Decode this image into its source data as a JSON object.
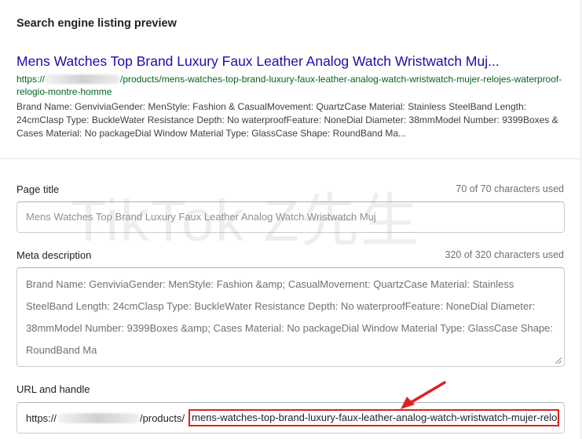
{
  "preview": {
    "heading": "Search engine listing preview",
    "title": "Mens Watches Top Brand Luxury Faux Leather Analog Watch Wristwatch Muj...",
    "url_prefix": "https://",
    "url_path": "/products/mens-watches-top-brand-luxury-faux-leather-analog-watch-wristwatch-mujer-relojes-waterproof-relogio-montre-homme",
    "description": "Brand Name: GenviviaGender: MenStyle: Fashion & CasualMovement: QuartzCase Material: Stainless SteelBand Length: 24cmClasp Type: BuckleWater Resistance Depth: No waterproofFeature: NoneDial Diameter: 38mmModel Number: 9399Boxes & Cases Material: No packageDial Window Material Type: GlassCase Shape: RoundBand Ma..."
  },
  "page_title": {
    "label": "Page title",
    "counter": "70 of 70 characters used",
    "value": "Mens Watches Top Brand Luxury Faux Leather Analog Watch Wristwatch Muj"
  },
  "meta_description": {
    "label": "Meta description",
    "counter": "320 of 320 characters used",
    "value": "Brand Name: GenviviaGender: MenStyle: Fashion &amp; CasualMovement: QuartzCase Material: Stainless SteelBand Length: 24cmClasp Type: BuckleWater Resistance Depth: No waterproofFeature: NoneDial Diameter: 38mmModel Number: 9399Boxes &amp; Cases Material: No packageDial Window Material Type: GlassCase Shape: RoundBand Ma"
  },
  "url_handle": {
    "label": "URL and handle",
    "prefix_start": "https://",
    "prefix_end": "/products/",
    "handle": "mens-watches-top-brand-luxury-faux-leather-analog-watch-wristwatch-mujer-relojes-waterproof-relogio-montre-homme"
  },
  "watermark": "TikTok Z先生",
  "colors": {
    "link_title": "#1a0dab",
    "url_green": "#006621",
    "highlight_red": "#e02020"
  },
  "icons": {
    "annotation_arrow": "red-arrow-icon",
    "resize": "resize-handle-icon"
  }
}
